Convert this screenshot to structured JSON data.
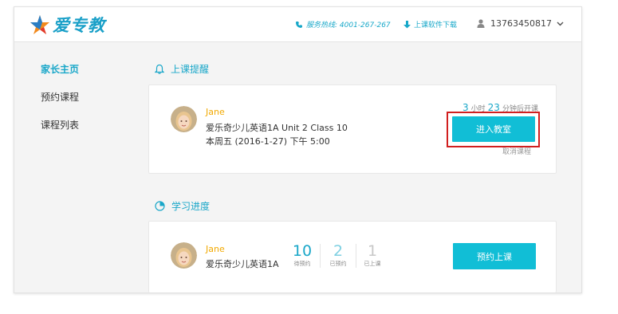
{
  "brand": {
    "name": "爱专教",
    "accent_color": "#1aa7c9"
  },
  "header": {
    "hotline": "服务热线: 4001-267-267",
    "download": "上课软件下载",
    "user_phone": "13763450817"
  },
  "sidebar": {
    "items": [
      {
        "label": "家长主页",
        "active": true
      },
      {
        "label": "预约课程",
        "active": false
      },
      {
        "label": "课程列表",
        "active": false
      }
    ]
  },
  "reminder": {
    "title": "上课提醒",
    "student_name": "Jane",
    "course": "爱乐奇少儿英语1A  Unit 2  Class 10",
    "time": "本周五 (2016-1-27) 下午 5:00",
    "countdown": {
      "hours": "3",
      "hours_unit": "小时",
      "minutes": "23",
      "minutes_unit": "分钟后开课"
    },
    "enter_label": "进入教室",
    "cancel_label": "取消课程"
  },
  "progress": {
    "title": "学习进度",
    "student_name": "Jane",
    "course": "爱乐奇少儿英语1A",
    "stats": [
      {
        "value": "10",
        "label": "待预约",
        "color": "#1aa7c9"
      },
      {
        "value": "2",
        "label": "已预约",
        "color": "#7fd0e2"
      },
      {
        "value": "1",
        "label": "已上课",
        "color": "#c8c8c8"
      }
    ],
    "book_label": "预约上课"
  }
}
